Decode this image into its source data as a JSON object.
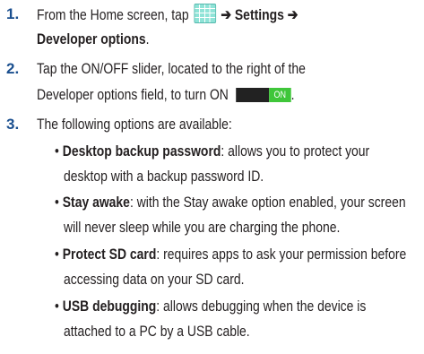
{
  "steps": [
    {
      "num": "1.",
      "line1_pre": "From the Home screen, tap",
      "line1_arrow1": "➔",
      "line1_bold": "Settings",
      "line1_arrow2": "➔",
      "line2_bold": "Developer options",
      "line2_end": "."
    },
    {
      "num": "2.",
      "line1": "Tap the ON/OFF slider, located to the right of the",
      "line2_pre": "Developer options field, to turn ON",
      "toggle_label": "ON",
      "line2_end": "."
    },
    {
      "num": "3.",
      "line1": "The following options are available:"
    }
  ],
  "bullet_char": "•",
  "options": [
    {
      "name": "Desktop backup password",
      "line1_rest": ": allows you to protect your",
      "line2": "desktop with a backup password ID."
    },
    {
      "name": "Stay awake",
      "line1_rest": ": with the Stay awake option enabled, your screen",
      "line2": "will never sleep while you are charging the phone."
    },
    {
      "name": "Protect SD card",
      "line1_rest": ": requires apps to ask your permission before",
      "line2": "accessing data on your SD card."
    },
    {
      "name": "USB debugging",
      "line1_rest": ": allows debugging when the device is",
      "line2": "attached to a PC by a USB cable."
    }
  ],
  "icons": {
    "apps": "apps-grid-icon",
    "toggle": "on-off-toggle-icon"
  },
  "colors": {
    "step_number": "#1a4f8f",
    "apps_icon": "#8fe3d7",
    "toggle_on": "#3fc63a",
    "toggle_off": "#222222"
  }
}
